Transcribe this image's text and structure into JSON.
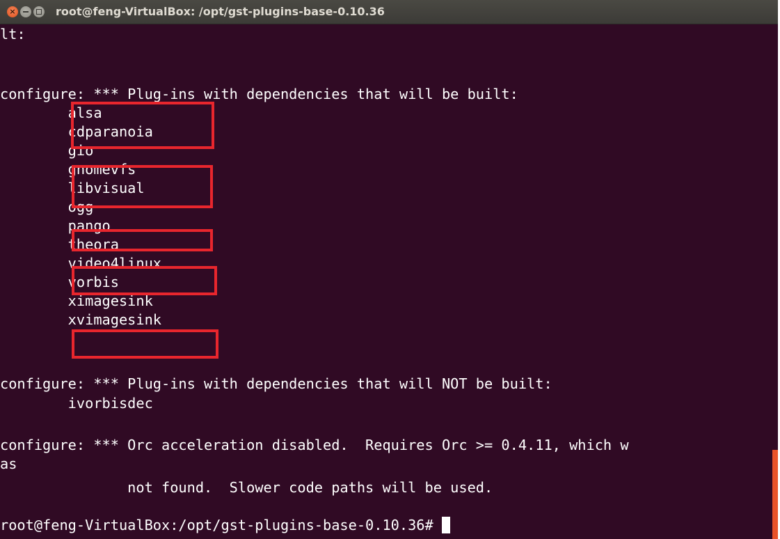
{
  "window": {
    "title": "root@feng-VirtualBox: /opt/gst-plugins-base-0.10.36",
    "controls": [
      "close-icon",
      "minimize-icon",
      "maximize-icon"
    ]
  },
  "terminal": {
    "lines": [
      "lt:",
      "",
      "configure: *** Plug-ins with dependencies that will be built:",
      "        alsa",
      "        cdparanoia",
      "        gio",
      "        gnomevfs",
      "        libvisual",
      "        ogg",
      "        pango",
      "        theora",
      "        video4linux",
      "        vorbis",
      "        ximagesink",
      "        xvimagesink",
      "",
      "configure: *** Plug-ins with dependencies that will NOT be built:",
      "        ivorbisdec",
      "",
      "configure: *** Orc acceleration disabled.  Requires Orc >= 0.4.11, which w",
      "as",
      "               not found.  Slower code paths will be used.",
      ""
    ],
    "prompt": "root@feng-VirtualBox:/opt/gst-plugins-base-0.10.36# "
  },
  "highlighted_plugins": [
    "alsa",
    "cdparanoia",
    "gnomevfs",
    "libvisual",
    "pango",
    "video4linux",
    "xvimagesink"
  ],
  "colors": {
    "terminal_bg": "#300a24",
    "text": "#ffffff",
    "highlight": "#e8262d"
  }
}
